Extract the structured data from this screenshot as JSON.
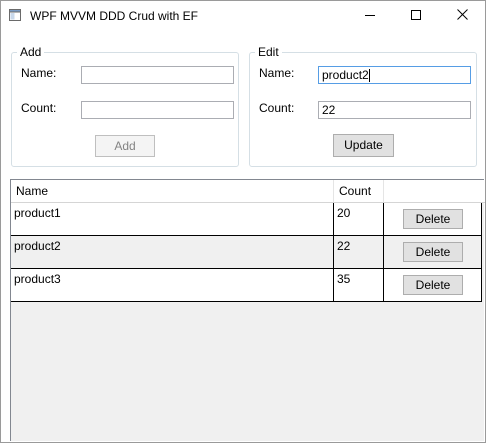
{
  "window": {
    "title": "WPF MVVM DDD Crud with EF"
  },
  "add_group": {
    "legend": "Add",
    "name_label": "Name:",
    "name_value": "",
    "count_label": "Count:",
    "count_value": "",
    "add_button": "Add"
  },
  "edit_group": {
    "legend": "Edit",
    "name_label": "Name:",
    "name_value": "product2",
    "count_label": "Count:",
    "count_value": "22",
    "update_button": "Update"
  },
  "grid": {
    "columns": [
      "Name",
      "Count",
      ""
    ],
    "rows": [
      {
        "name": "product1",
        "count": "20",
        "action": "Delete"
      },
      {
        "name": "product2",
        "count": "22",
        "action": "Delete"
      },
      {
        "name": "product3",
        "count": "35",
        "action": "Delete"
      }
    ]
  },
  "icons": {
    "app": "window-app-icon",
    "minimize": "minimize-icon",
    "maximize": "maximize-icon",
    "close": "close-icon"
  },
  "colors": {
    "focus_border": "#569de5",
    "button_face": "#e1e1e1",
    "grid_alt_row": "#f0f0f0"
  }
}
